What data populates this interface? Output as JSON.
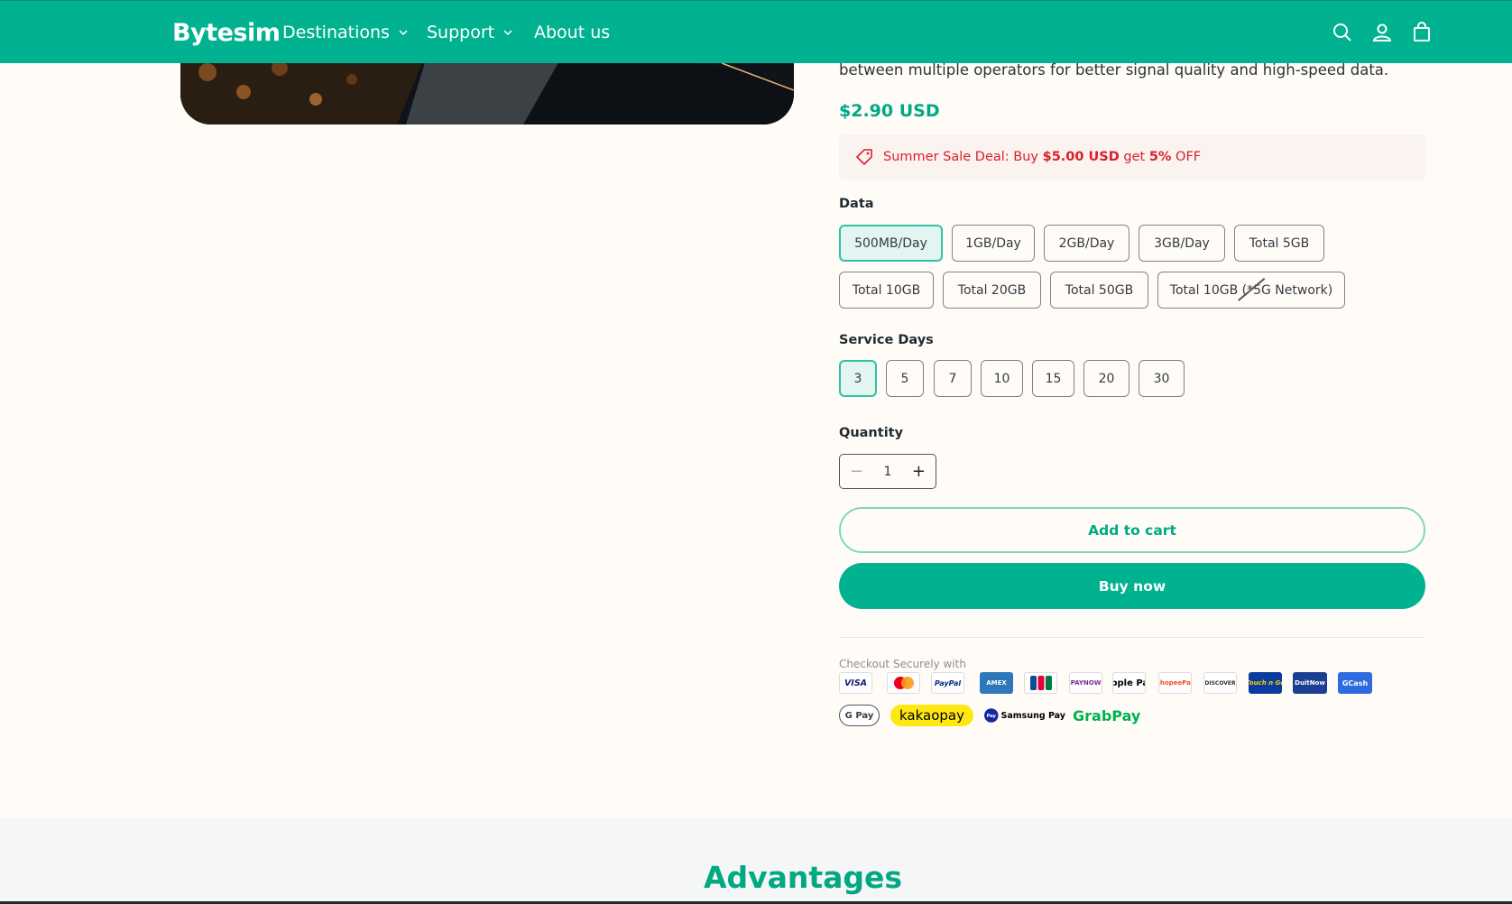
{
  "header": {
    "logo": "Bytesim",
    "nav": [
      {
        "label": "Destinations"
      },
      {
        "label": "Support"
      },
      {
        "label": "About us"
      }
    ]
  },
  "product": {
    "description_tail": "between multiple operators for better signal quality and high-speed data.",
    "price": "$2.90 USD",
    "sale": {
      "prefix": "Summer Sale Deal: Buy ",
      "amount": "$5.00 USD",
      "middle": " get ",
      "percent": "5%",
      "suffix": " OFF"
    },
    "data_label": "Data",
    "data_options": [
      "500MB/Day",
      "1GB/Day",
      "2GB/Day",
      "3GB/Day",
      "Total 5GB",
      "Total 10GB",
      "Total 20GB",
      "Total 50GB",
      "Total 10GB (*5G Network)"
    ],
    "data_selected": "500MB/Day",
    "days_label": "Service Days",
    "days_options": [
      "3",
      "5",
      "7",
      "10",
      "15",
      "20",
      "30"
    ],
    "days_selected": "3",
    "quantity_label": "Quantity",
    "quantity_value": "1",
    "add_to_cart": "Add to cart",
    "buy_now": "Buy now",
    "checkout_label": "Checkout Securely with",
    "payment_methods": [
      "VISA",
      "Mastercard",
      "PayPal",
      "AMEX",
      "JCB",
      "PAYNOW",
      "Apple Pay",
      "ShopeePay",
      "DISCOVER",
      "Touch n Go",
      "DuitNow",
      "GCash",
      "G Pay",
      "kakaopay",
      "Samsung Pay",
      "GrabPay"
    ]
  },
  "advantages": {
    "title": "Advantages"
  },
  "colors": {
    "brand": "#00b28f",
    "sale_red": "#d9202b",
    "selected_bg": "#e3f5f0"
  }
}
